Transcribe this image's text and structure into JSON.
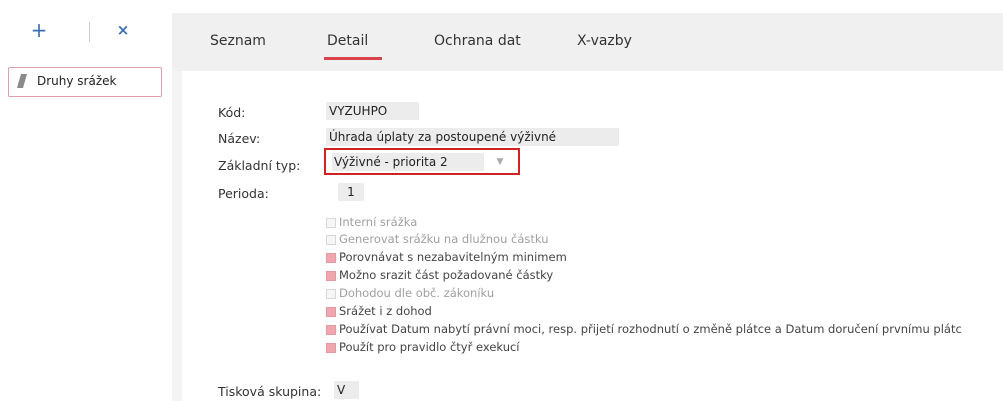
{
  "left_panel": {
    "toolbar": {
      "add_glyph": "+",
      "close_glyph": "×"
    },
    "item_label": "Druhy srážek",
    "item_icon": "pencil-icon"
  },
  "tabs": [
    {
      "label": "Seznam"
    },
    {
      "label": "Detail",
      "active": true
    },
    {
      "label": "Ochrana dat"
    },
    {
      "label": "X-vazby"
    }
  ],
  "form": {
    "kod": {
      "label": "Kód:",
      "value": "VYZUHPO"
    },
    "nazev": {
      "label": "Název:",
      "value": "Úhrada úplaty za postoupené výživné"
    },
    "zakladni_typ": {
      "label": "Základní typ:",
      "value": "Výživné - priorita 2"
    },
    "perioda": {
      "label": "Perioda:",
      "value": "1"
    },
    "checkboxes": [
      {
        "label": "Interní srážka",
        "checked": false,
        "enabled": false
      },
      {
        "label": "Generovat srážku na dlužnou částku",
        "checked": false,
        "enabled": false
      },
      {
        "label": "Porovnávat s nezabavitelným minimem",
        "checked": true,
        "enabled": true
      },
      {
        "label": "Možno srazit část požadované částky",
        "checked": true,
        "enabled": true
      },
      {
        "label": "Dohodou dle obč. zákoníku",
        "checked": false,
        "enabled": false
      },
      {
        "label": "Srážet i z dohod",
        "checked": true,
        "enabled": true
      },
      {
        "label": "Používat Datum nabytí právní moci, resp. přijetí rozhodnutí o změně plátce a Datum doručení prvnímu plátc",
        "checked": true,
        "enabled": true
      },
      {
        "label": "Použít pro pravidlo čtyř exekucí",
        "checked": true,
        "enabled": true
      }
    ],
    "tiskova_skupina": {
      "label": "Tisková skupina:",
      "value": "V"
    }
  },
  "colors": {
    "accent": "#d9434b",
    "highlight_border": "#d32020",
    "checkbox_checked": "#f0a6ae"
  }
}
